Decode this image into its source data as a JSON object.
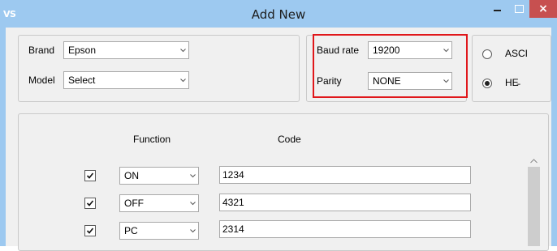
{
  "window": {
    "app_icon_text": "VS",
    "title": "Add New",
    "close_glyph": "×"
  },
  "device": {
    "brand_label": "Brand",
    "brand_value": "Epson",
    "model_label": "Model",
    "model_value": "Select"
  },
  "serial": {
    "baud_label": "Baud rate",
    "baud_value": "19200",
    "parity_label": "Parity",
    "parity_value": "NONE"
  },
  "mode": {
    "options": [
      {
        "label": "ASCI",
        "selected": false
      },
      {
        "label": "HE̵",
        "selected": true
      }
    ]
  },
  "codes": {
    "function_header": "Function",
    "code_header": "Code",
    "rows": [
      {
        "checked": true,
        "function": "ON",
        "code": "1234"
      },
      {
        "checked": true,
        "function": "OFF",
        "code": "4321"
      },
      {
        "checked": true,
        "function": "PC",
        "code": "2314"
      }
    ]
  },
  "colors": {
    "titlebar": "#9dc9f0",
    "close_button": "#c75050",
    "highlight": "#e0171b"
  },
  "icons": [
    "app-icon",
    "minimize-icon",
    "maximize-icon",
    "close-icon",
    "chevron-down-icon",
    "radio-icon",
    "checkbox-icon",
    "scroll-up-icon"
  ]
}
